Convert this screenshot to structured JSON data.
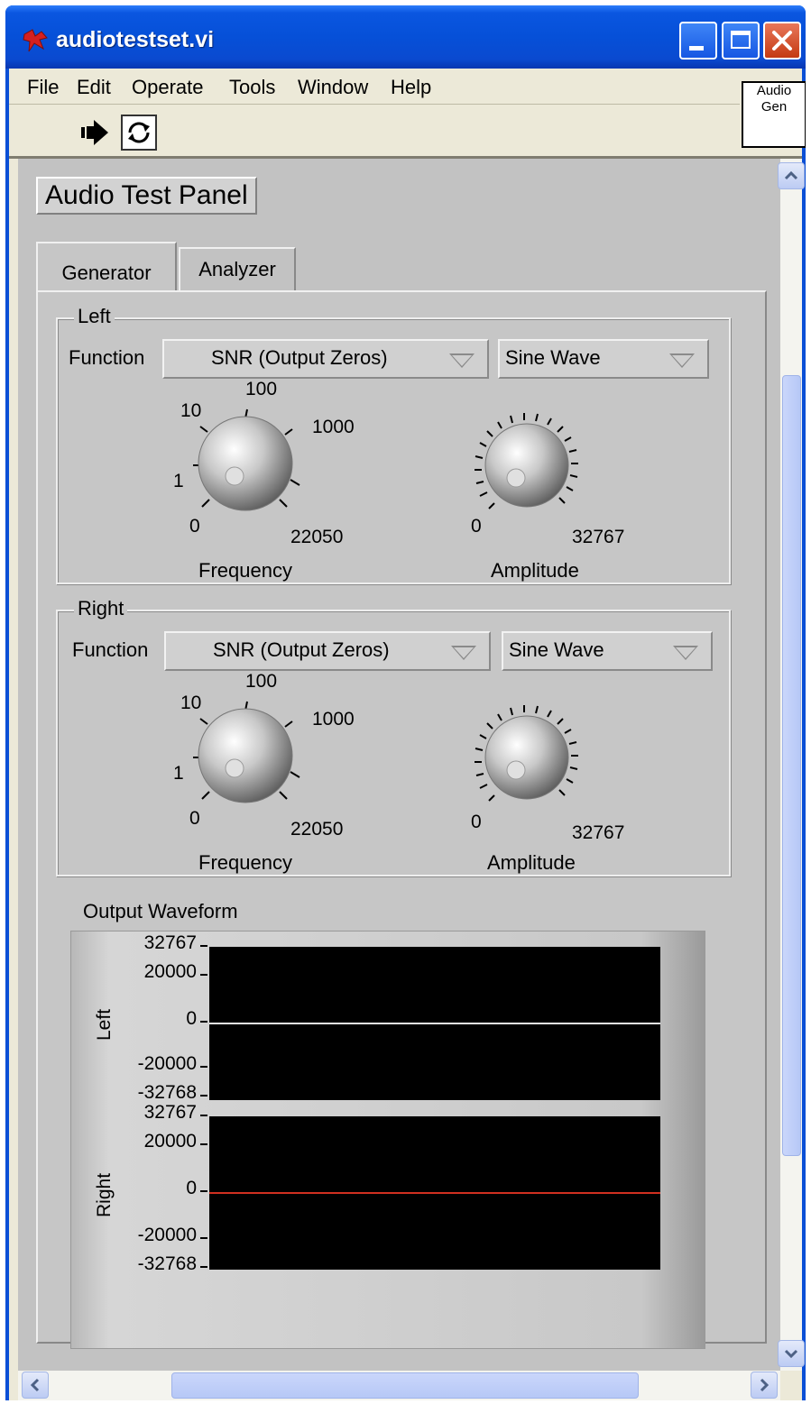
{
  "window": {
    "title": "audiotestset.vi"
  },
  "menu": [
    "File",
    "Edit",
    "Operate",
    "Tools",
    "Window",
    "Help"
  ],
  "icon_pane": {
    "line1": "Audio",
    "line2": "Gen"
  },
  "panel": {
    "title": "Audio Test Panel"
  },
  "tabs": [
    {
      "label": "Generator",
      "active": true
    },
    {
      "label": "Analyzer",
      "active": false
    }
  ],
  "channels": [
    {
      "group_label": "Left",
      "function_label": "Function",
      "function_value": "SNR (Output Zeros)",
      "waveform_value": "Sine Wave",
      "frequency": {
        "label": "Frequency",
        "scale": [
          "0",
          "1",
          "10",
          "100",
          "1000",
          "22050"
        ]
      },
      "amplitude": {
        "label": "Amplitude",
        "min": "0",
        "max": "32767"
      }
    },
    {
      "group_label": "Right",
      "function_label": "Function",
      "function_value": "SNR (Output Zeros)",
      "waveform_value": "Sine Wave",
      "frequency": {
        "label": "Frequency",
        "scale": [
          "0",
          "1",
          "10",
          "100",
          "1000",
          "22050"
        ]
      },
      "amplitude": {
        "label": "Amplitude",
        "min": "0",
        "max": "32767"
      }
    }
  ],
  "graph": {
    "title": "Output Waveform",
    "plots": [
      {
        "name": "Left",
        "ticks": [
          "32767",
          "20000",
          "0",
          "-20000",
          "-32768"
        ],
        "trace_color": "#e8e8e8"
      },
      {
        "name": "Right",
        "ticks": [
          "32767",
          "20000",
          "0",
          "-20000",
          "-32768"
        ],
        "trace_color": "#d03020"
      }
    ]
  },
  "colors": {
    "title_bar": "#0a4fd6",
    "panel_bg": "#c6c6c6",
    "plot_bg": "#000000"
  }
}
